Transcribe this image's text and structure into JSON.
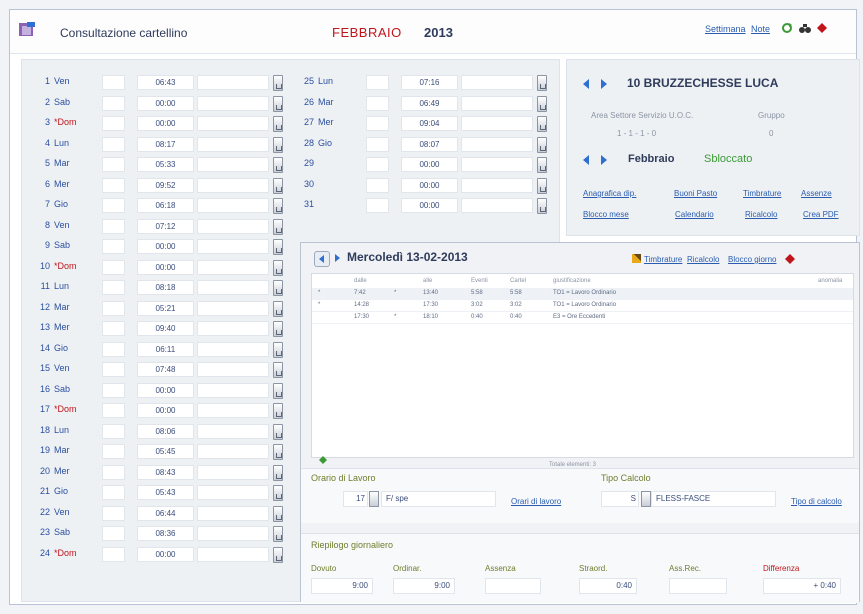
{
  "header": {
    "app_title": "Consultazione cartellino",
    "month": "FEBBRAIO",
    "year": "2013",
    "links": [
      "Settimana",
      "Note"
    ]
  },
  "days": [
    {
      "num": "1",
      "name": "Ven",
      "time": "06:43",
      "sunday": false
    },
    {
      "num": "2",
      "name": "Sab",
      "time": "00:00",
      "sunday": false
    },
    {
      "num": "3",
      "name": "*Dom",
      "time": "00:00",
      "sunday": true
    },
    {
      "num": "4",
      "name": "Lun",
      "time": "08:17",
      "sunday": false
    },
    {
      "num": "5",
      "name": "Mar",
      "time": "05:33",
      "sunday": false
    },
    {
      "num": "6",
      "name": "Mer",
      "time": "09:52",
      "sunday": false
    },
    {
      "num": "7",
      "name": "Gio",
      "time": "06:18",
      "sunday": false
    },
    {
      "num": "8",
      "name": "Ven",
      "time": "07:12",
      "sunday": false
    },
    {
      "num": "9",
      "name": "Sab",
      "time": "00:00",
      "sunday": false
    },
    {
      "num": "10",
      "name": "*Dom",
      "time": "00:00",
      "sunday": true
    },
    {
      "num": "11",
      "name": "Lun",
      "time": "08:18",
      "sunday": false
    },
    {
      "num": "12",
      "name": "Mar",
      "time": "05:21",
      "sunday": false
    },
    {
      "num": "13",
      "name": "Mer",
      "time": "09:40",
      "sunday": false
    },
    {
      "num": "14",
      "name": "Gio",
      "time": "06:11",
      "sunday": false
    },
    {
      "num": "15",
      "name": "Ven",
      "time": "07:48",
      "sunday": false
    },
    {
      "num": "16",
      "name": "Sab",
      "time": "00:00",
      "sunday": false
    },
    {
      "num": "17",
      "name": "*Dom",
      "time": "00:00",
      "sunday": true
    },
    {
      "num": "18",
      "name": "Lun",
      "time": "08:06",
      "sunday": false
    },
    {
      "num": "19",
      "name": "Mar",
      "time": "05:45",
      "sunday": false
    },
    {
      "num": "20",
      "name": "Mer",
      "time": "08:43",
      "sunday": false
    },
    {
      "num": "21",
      "name": "Gio",
      "time": "05:43",
      "sunday": false
    },
    {
      "num": "22",
      "name": "Ven",
      "time": "06:44",
      "sunday": false
    },
    {
      "num": "23",
      "name": "Sab",
      "time": "08:36",
      "sunday": false
    },
    {
      "num": "24",
      "name": "*Dom",
      "time": "00:00",
      "sunday": true
    },
    {
      "num": "25",
      "name": "Lun",
      "time": "07:16",
      "sunday": false
    },
    {
      "num": "26",
      "name": "Mar",
      "time": "06:49",
      "sunday": false
    },
    {
      "num": "27",
      "name": "Mer",
      "time": "09:04",
      "sunday": false
    },
    {
      "num": "28",
      "name": "Gio",
      "time": "08:07",
      "sunday": false
    },
    {
      "num": "29",
      "name": "",
      "time": "00:00",
      "sunday": false
    },
    {
      "num": "30",
      "name": "",
      "time": "00:00",
      "sunday": false
    },
    {
      "num": "31",
      "name": "",
      "time": "00:00",
      "sunday": false
    }
  ],
  "info": {
    "employee": "10 BRUZZECHESSE LUCA",
    "org_label": "Area Settore Servizio U.O.C.",
    "org_value": "1 - 1 - 1 - 0",
    "group_label": "Gruppo",
    "group_value": "0",
    "month_name": "Febbraio",
    "status": "Sbloccato",
    "links": [
      "Anagrafica dip.",
      "Buoni Pasto",
      "Timbrature",
      "Assenze",
      "Blocco mese",
      "Calendario",
      "Ricalcolo",
      "Crea PDF"
    ]
  },
  "detail": {
    "date": "Mercoledì 13-02-2013",
    "links": [
      "Timbrature",
      "Ricalcolo",
      "Blocco giorno"
    ],
    "columns": [
      "dalle",
      "alle",
      "Eventi",
      "Cartel",
      "giustificazione",
      "anomalia"
    ],
    "rows": [
      {
        "mark1": "*",
        "dalle": "7:42",
        "mark2": "*",
        "alle": "13:40",
        "eventi": "5:58",
        "cartel": "5:58",
        "giust": "TO1 = Lavoro Ordinario"
      },
      {
        "mark1": "*",
        "dalle": "14:28",
        "mark2": "",
        "alle": "17:30",
        "eventi": "3:02",
        "cartel": "3:02",
        "giust": "TO1 = Lavoro Ordinario"
      },
      {
        "mark1": "",
        "dalle": "17:30",
        "mark2": "*",
        "alle": "18:10",
        "eventi": "0:40",
        "cartel": "0:40",
        "giust": "E3 = Ore Eccedenti"
      }
    ],
    "total_label": "Totale elementi: 3",
    "orario_label": "Orario di Lavoro",
    "orario_code": "17",
    "orario_desc": "F/ spe",
    "orario_link": "Orari di lavoro",
    "tipo_label": "Tipo Calcolo",
    "tipo_code": "S",
    "tipo_value": "FLESS-FASCE",
    "tipo_link": "Tipo di calcolo",
    "summary_title": "Riepilogo giornaliero",
    "summary": [
      {
        "label": "Dovuto",
        "value": "9:00"
      },
      {
        "label": "Ordinar.",
        "value": "9:00"
      },
      {
        "label": "Assenza",
        "value": ""
      },
      {
        "label": "Straord.",
        "value": "0:40"
      },
      {
        "label": "Ass.Rec.",
        "value": ""
      },
      {
        "label": "Differenza",
        "value": "+ 0:40"
      }
    ]
  }
}
